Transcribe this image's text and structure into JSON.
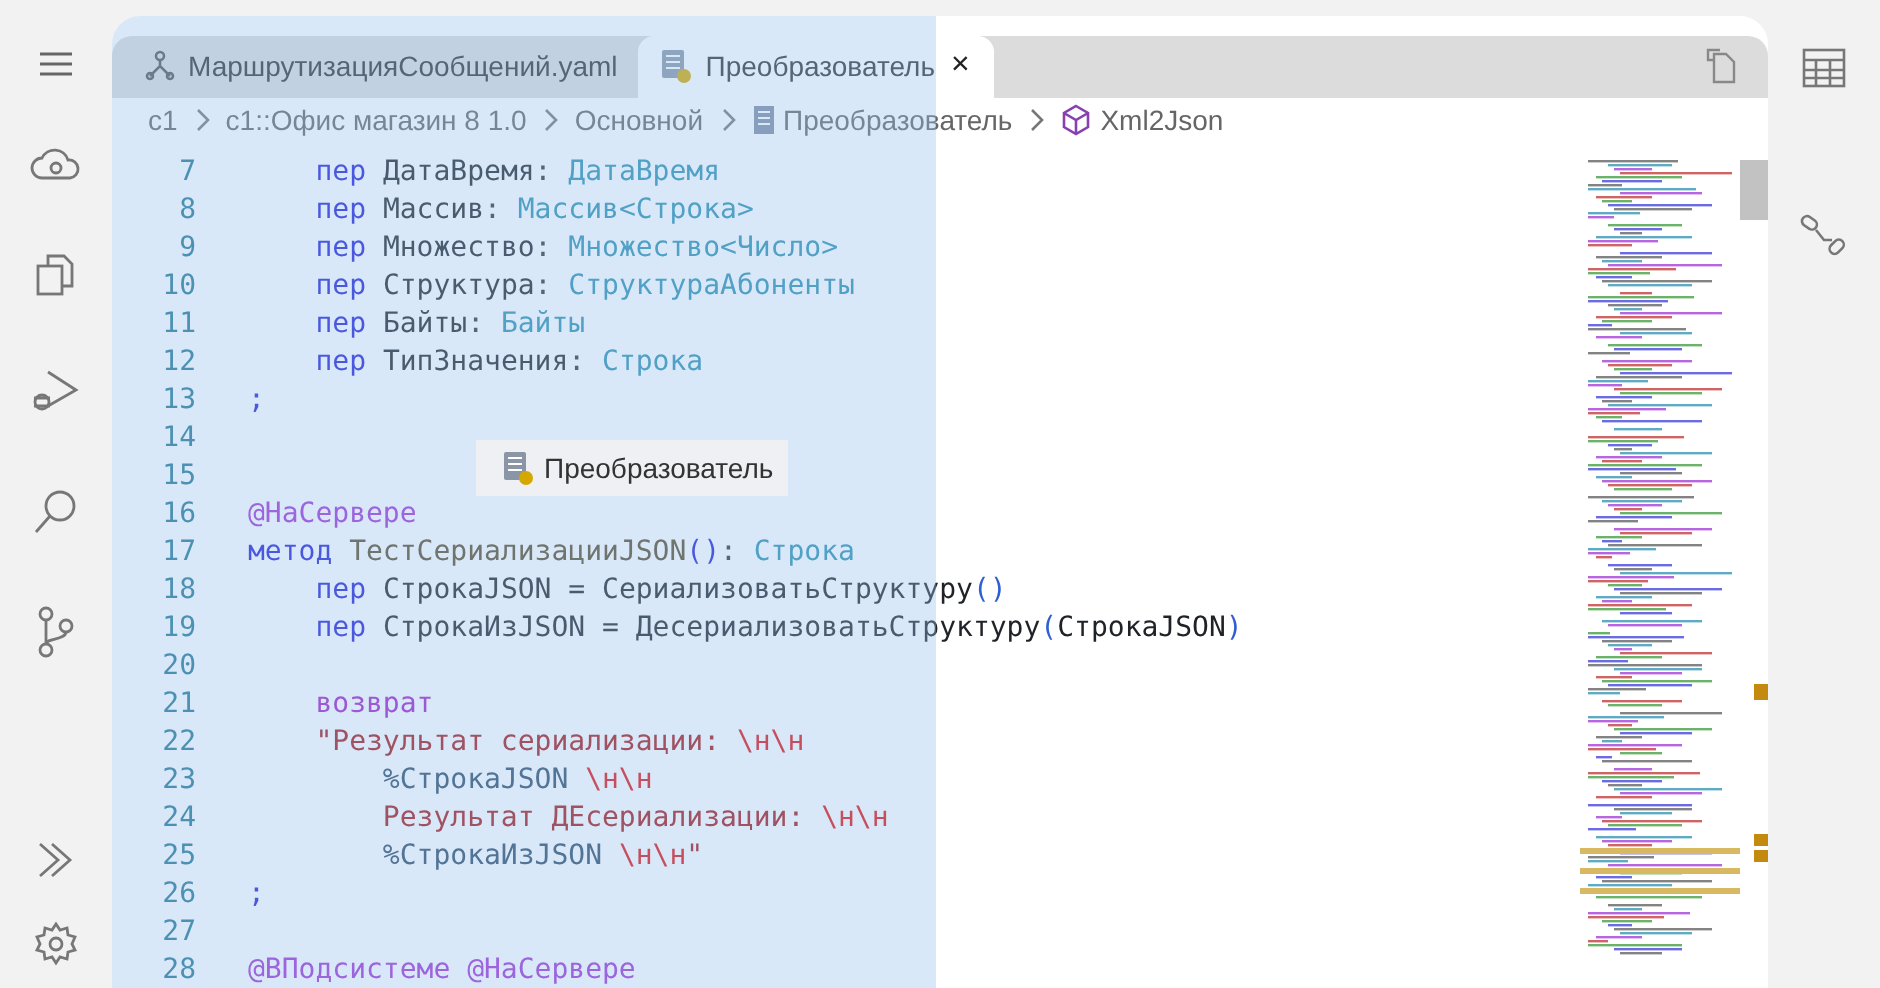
{
  "tabs": [
    {
      "label": "МаршрутизацияСообщений.yaml",
      "kind": "yaml",
      "selected": false
    },
    {
      "label": "Преобразователь",
      "kind": "module",
      "selected": true,
      "close": "×"
    }
  ],
  "breadcrumb": [
    {
      "label": "c1",
      "kind": "text"
    },
    {
      "label": "c1::Офис магазин 8 1.0",
      "kind": "text"
    },
    {
      "label": "Основной",
      "kind": "text"
    },
    {
      "label": "Преобразователь",
      "kind": "module"
    },
    {
      "label": "Xml2Json",
      "kind": "structure"
    }
  ],
  "code_lines": [
    {
      "number": "7",
      "tokens": [
        {
          "text": "    пер ",
          "kind": "keyword"
        },
        {
          "text": "ДатаВремя",
          "kind": "ident"
        },
        {
          "text": ": ",
          "kind": "punct"
        },
        {
          "text": "ДатаВремя",
          "kind": "type"
        }
      ]
    },
    {
      "number": "8",
      "tokens": [
        {
          "text": "    пер ",
          "kind": "keyword"
        },
        {
          "text": "Массив",
          "kind": "ident"
        },
        {
          "text": ": ",
          "kind": "punct"
        },
        {
          "text": "Массив<Строка>",
          "kind": "type"
        }
      ]
    },
    {
      "number": "9",
      "tokens": [
        {
          "text": "    пер ",
          "kind": "keyword"
        },
        {
          "text": "Множество",
          "kind": "ident"
        },
        {
          "text": ": ",
          "kind": "punct"
        },
        {
          "text": "Множество<Число>",
          "kind": "type"
        }
      ]
    },
    {
      "number": "10",
      "tokens": [
        {
          "text": "    пер ",
          "kind": "keyword"
        },
        {
          "text": "Структура",
          "kind": "ident"
        },
        {
          "text": ": ",
          "kind": "punct"
        },
        {
          "text": "СтруктураАбоненты",
          "kind": "type"
        }
      ]
    },
    {
      "number": "11",
      "tokens": [
        {
          "text": "    пер ",
          "kind": "keyword"
        },
        {
          "text": "Байты",
          "kind": "ident"
        },
        {
          "text": ": ",
          "kind": "punct"
        },
        {
          "text": "Байты",
          "kind": "type"
        }
      ]
    },
    {
      "number": "12",
      "tokens": [
        {
          "text": "    пер ",
          "kind": "keyword"
        },
        {
          "text": "ТипЗначения",
          "kind": "ident"
        },
        {
          "text": ": ",
          "kind": "punct"
        },
        {
          "text": "Строка",
          "kind": "type"
        }
      ]
    },
    {
      "number": "13",
      "tokens": [
        {
          "text": ";",
          "kind": "keyword"
        }
      ]
    },
    {
      "number": "14"
    },
    {
      "number": "15"
    },
    {
      "number": "16",
      "tokens": [
        {
          "text": "@НаСервере",
          "kind": "annotation"
        }
      ]
    },
    {
      "number": "17",
      "tokens": [
        {
          "text": "метод ",
          "kind": "keyword"
        },
        {
          "text": "ТестСериализацииJSON",
          "kind": "function"
        },
        {
          "text": "()",
          "kind": "keyword"
        },
        {
          "text": ": ",
          "kind": "punct"
        },
        {
          "text": "Строка",
          "kind": "type"
        }
      ]
    },
    {
      "number": "18",
      "tokens": [
        {
          "text": "    пер ",
          "kind": "keyword"
        },
        {
          "text": "СтрокаJSON = СериализоватьСтруктуру",
          "kind": "ident"
        },
        {
          "text": "()",
          "kind": "paren"
        }
      ]
    },
    {
      "number": "19",
      "tokens": [
        {
          "text": "    пер ",
          "kind": "keyword"
        },
        {
          "text": "СтрокаИзJSON = ДесериализоватьСтруктуру",
          "kind": "ident"
        },
        {
          "text": "(",
          "kind": "paren"
        },
        {
          "text": "СтрокаJSON",
          "kind": "ident"
        },
        {
          "text": ")",
          "kind": "paren"
        }
      ]
    },
    {
      "number": "20"
    },
    {
      "number": "21",
      "tokens": [
        {
          "text": "    возврат",
          "kind": "control"
        }
      ]
    },
    {
      "number": "22",
      "tokens": [
        {
          "text": "    \"Результат сериализации: ",
          "kind": "string"
        },
        {
          "text": "\\н\\н",
          "kind": "escape"
        }
      ]
    },
    {
      "number": "23",
      "tokens": [
        {
          "text": "        %СтрокаJSON ",
          "kind": "interp"
        },
        {
          "text": "\\н\\н",
          "kind": "escape"
        }
      ]
    },
    {
      "number": "24",
      "tokens": [
        {
          "text": "        Результат ДЕсериализации: ",
          "kind": "string"
        },
        {
          "text": "\\н\\н",
          "kind": "escape"
        }
      ]
    },
    {
      "number": "25",
      "tokens": [
        {
          "text": "        %СтрокаИзJSON ",
          "kind": "interp"
        },
        {
          "text": "\\н\\н",
          "kind": "escape"
        },
        {
          "text": "\"",
          "kind": "string"
        }
      ]
    },
    {
      "number": "26",
      "tokens": [
        {
          "text": ";",
          "kind": "keyword"
        }
      ]
    },
    {
      "number": "27"
    },
    {
      "number": "28",
      "tokens": [
        {
          "text": "@ВПодсистеме @НаСервере",
          "kind": "annotation"
        }
      ]
    }
  ],
  "drag_preview": {
    "label": "Преобразователь"
  }
}
